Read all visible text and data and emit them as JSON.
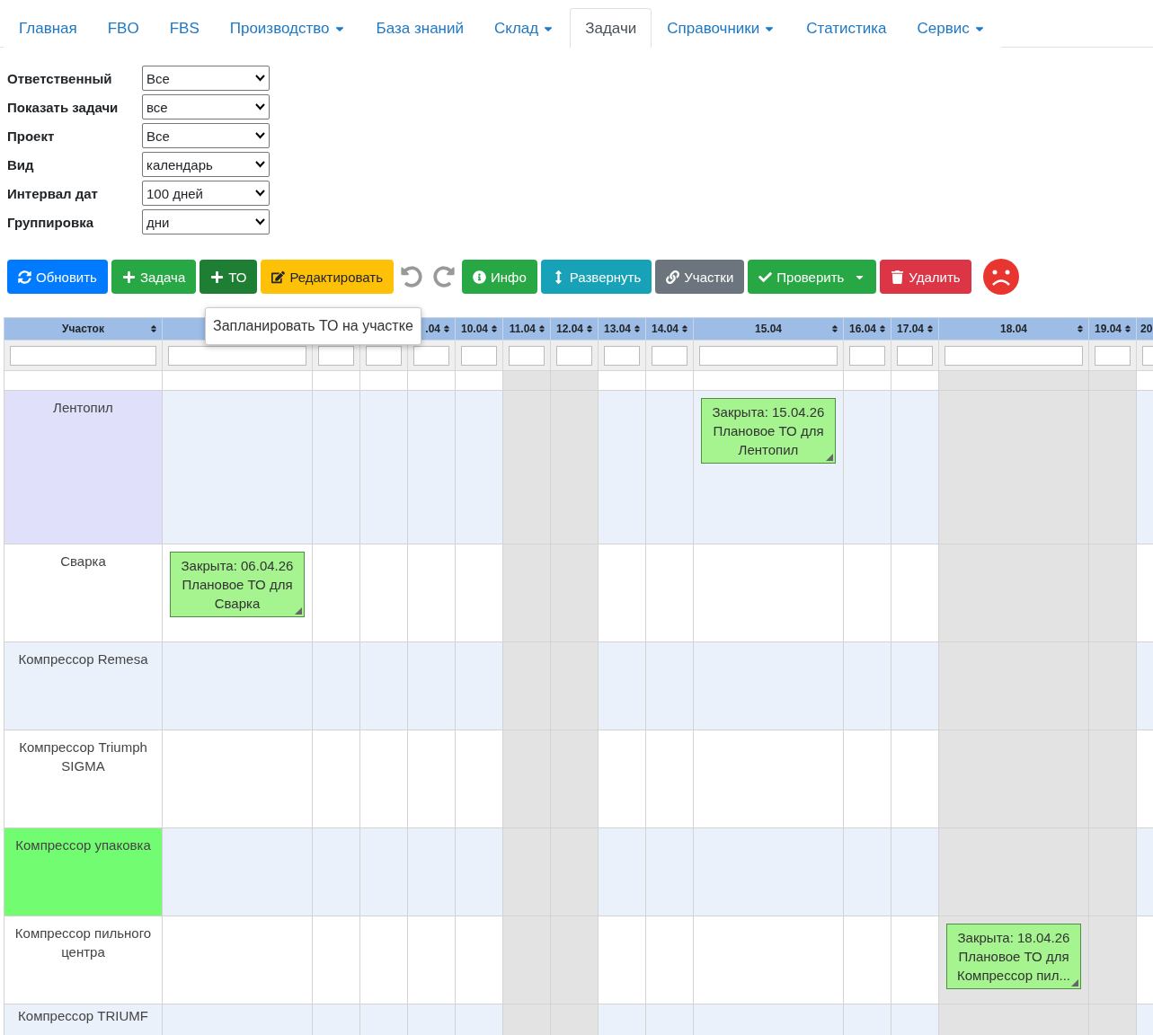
{
  "nav": {
    "tabs": [
      {
        "label": "Главная",
        "selected": false,
        "dropdown": false
      },
      {
        "label": "FBO",
        "selected": false,
        "dropdown": false
      },
      {
        "label": "FBS",
        "selected": false,
        "dropdown": false
      },
      {
        "label": "Производство",
        "selected": false,
        "dropdown": true
      },
      {
        "label": "База знаний",
        "selected": false,
        "dropdown": false
      },
      {
        "label": "Склад",
        "selected": false,
        "dropdown": true
      },
      {
        "label": "Задачи",
        "selected": true,
        "dropdown": false
      },
      {
        "label": "Справочники",
        "selected": false,
        "dropdown": true
      },
      {
        "label": "Статистика",
        "selected": false,
        "dropdown": false
      },
      {
        "label": "Сервис",
        "selected": false,
        "dropdown": true
      }
    ]
  },
  "filters": [
    {
      "label": "Ответственный",
      "value": "Все"
    },
    {
      "label": "Показать задачи",
      "value": "все"
    },
    {
      "label": "Проект",
      "value": "Все"
    },
    {
      "label": "Вид",
      "value": "календарь"
    },
    {
      "label": "Интервал дат",
      "value": "100 дней"
    },
    {
      "label": "Группировка",
      "value": "дни"
    }
  ],
  "toolbar": [
    {
      "kind": "button",
      "label": "Обновить",
      "caret": false
    },
    {
      "kind": "button",
      "label": "Задача",
      "caret": false
    },
    {
      "kind": "button",
      "label": "ТО",
      "caret": false
    },
    {
      "kind": "button",
      "label": "Редактировать",
      "caret": false
    },
    {
      "kind": "icon-button",
      "disabled": true
    },
    {
      "kind": "icon-button",
      "disabled": true
    },
    {
      "kind": "button",
      "label": "Инфо",
      "caret": false
    },
    {
      "kind": "button",
      "label": "Развернуть",
      "caret": false
    },
    {
      "kind": "button",
      "label": "Участки",
      "caret": false
    },
    {
      "kind": "button",
      "label": "Проверить",
      "caret": true
    },
    {
      "kind": "button",
      "label": "Удалить",
      "caret": false
    },
    {
      "kind": "status"
    }
  ],
  "tooltip": {
    "text": "Запланировать ТО на участке"
  },
  "table": {
    "first_column": {
      "label": "Участок"
    },
    "columns": [
      {
        "weekend": false
      },
      {
        "weekend": false
      },
      {
        "weekend": false
      },
      {
        "label": ".04",
        "weekend": false
      },
      {
        "label": "10.04",
        "weekend": false
      },
      {
        "label": "11.04",
        "weekend": true
      },
      {
        "label": "12.04",
        "weekend": true
      },
      {
        "label": "13.04",
        "weekend": false
      },
      {
        "label": "14.04",
        "weekend": false
      },
      {
        "label": "15.04",
        "weekend": false
      },
      {
        "label": "16.04",
        "weekend": false
      },
      {
        "label": "17.04",
        "weekend": false
      },
      {
        "label": "18.04",
        "weekend": true
      },
      {
        "label": "19.04",
        "weekend": true
      },
      {
        "label": "20",
        "weekend": false
      }
    ],
    "rows": [
      {
        "name": "Лентопил",
        "color": "#e0e0fa",
        "cells": [
          null,
          null,
          null,
          null,
          null,
          null,
          null,
          null,
          null,
          {
            "status": "Закрыта: 15.04.26",
            "title": "Плановое ТО для Лентопил"
          },
          null,
          null,
          null,
          null,
          null
        ]
      },
      {
        "name": "Сварка",
        "cells": [
          {
            "status": "Закрыта: 06.04.26",
            "title": "Плановое ТО для Сварка"
          },
          null,
          null,
          null,
          null,
          null,
          null,
          null,
          null,
          null,
          null,
          null,
          null,
          null,
          null
        ]
      },
      {
        "name": "Компрессор Remesa",
        "cells": [
          null,
          null,
          null,
          null,
          null,
          null,
          null,
          null,
          null,
          null,
          null,
          null,
          null,
          null,
          null
        ]
      },
      {
        "name": "Компрессор Triumph SIGMA",
        "cells": [
          null,
          null,
          null,
          null,
          null,
          null,
          null,
          null,
          null,
          null,
          null,
          null,
          null,
          null,
          null
        ]
      },
      {
        "name": "Компрессор упаковка",
        "color": "#72fc72",
        "cells": [
          null,
          null,
          null,
          null,
          null,
          null,
          null,
          null,
          null,
          null,
          null,
          null,
          null,
          null,
          null
        ]
      },
      {
        "name": "Компрессор пильного центра",
        "cells": [
          null,
          null,
          null,
          null,
          null,
          null,
          null,
          null,
          null,
          null,
          null,
          null,
          {
            "status": "Закрыта: 18.04.26",
            "title": "Плановое ТО для Компрессор пил..."
          },
          null,
          null
        ]
      },
      {
        "name": "Компрессор TRIUMF",
        "cells": [
          null,
          null,
          null,
          null,
          null,
          null,
          null,
          null,
          null,
          null,
          null,
          null,
          null,
          null,
          null
        ]
      }
    ]
  }
}
